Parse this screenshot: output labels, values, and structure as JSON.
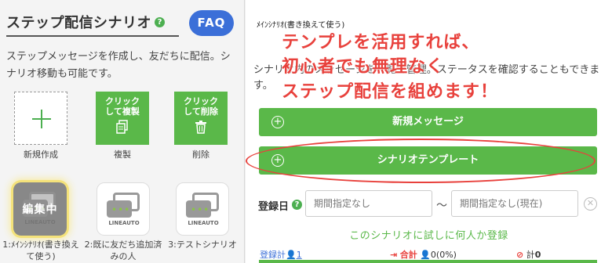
{
  "left": {
    "title": "ステップ配信シナリオ",
    "help_icon": "?",
    "faq_label": "FAQ",
    "description": "ステップメッセージを作成し、友だちに配信。シナリオ移動も可能です。",
    "tiles": {
      "new_label": "新規作成",
      "copy_text": "クリック\nして複製",
      "copy_label": "複製",
      "delete_text": "クリック\nして削除",
      "delete_label": "削除"
    },
    "scenarios": [
      {
        "caption": "1:ﾒｲﾝｼﾅﾘｵ(書き換えて使う)",
        "badge": "編集中",
        "logo": "LINEAUTO"
      },
      {
        "caption": "2:既に友だち追加済みの人",
        "logo": "LINEAUTO"
      },
      {
        "caption": "3:テストシナリオ",
        "logo": "LINEAUTO"
      }
    ]
  },
  "right": {
    "scenario_name": "ﾒｲﾝｼﾅﾘｵ(書き換えて使う)",
    "overlay_lines": [
      "テンプレを活用すれば、",
      "初心者でも無理なく",
      "ステップ配信を組めます！"
    ],
    "description": "シナリオ内のメッセージを一覧で管理。ステータスを確認することもできます。",
    "new_message_label": "新規メッセージ",
    "template_label": "シナリオテンプレート",
    "registration_label": "登録日",
    "date_from_placeholder": "期間指定なし",
    "date_to_placeholder": "期間指定なし(現在)",
    "tilde": "〜",
    "trial_link": "このシナリオに試しに何人か登録",
    "stats": {
      "registered_label": "登録計",
      "registered_value": "1",
      "outflow_label": "合計",
      "outflow_value": "0(0%)",
      "stopped_label": "計",
      "stopped_value": "0"
    }
  },
  "colors": {
    "green": "#5ab849",
    "blue": "#3b6fd8",
    "red": "#e8413c"
  }
}
